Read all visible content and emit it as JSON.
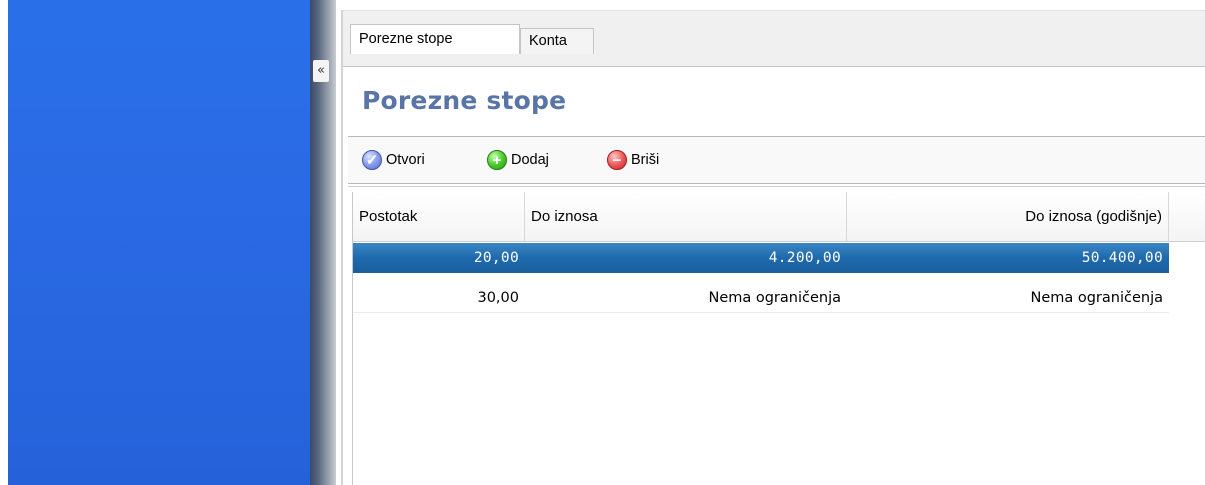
{
  "collapse_glyph": "«",
  "tabs": [
    {
      "label": "Porezne stope",
      "active": true
    },
    {
      "label": "Konta",
      "active": false
    }
  ],
  "page": {
    "title": "Porezne stope"
  },
  "toolbar": {
    "open_label": "Otvori",
    "add_label": "Dodaj",
    "delete_label": "Briši",
    "add_glyph": "+",
    "delete_glyph": "−",
    "open_glyph": "✓"
  },
  "grid": {
    "columns": [
      "Postotak",
      "Do iznosa",
      "Do iznosa (godišnje)"
    ],
    "rows": [
      {
        "postotak": "20,00",
        "do_iznosa": "4.200,00",
        "godisnje": "50.400,00",
        "selected": true
      },
      {
        "postotak": "30,00",
        "do_iznosa": "Nema ograničenja",
        "godisnje": "Nema ograničenja",
        "selected": false
      }
    ]
  },
  "colors": {
    "sidebar": "#2a6ae4",
    "title": "#5975a8",
    "selection": "#1f6aad"
  }
}
